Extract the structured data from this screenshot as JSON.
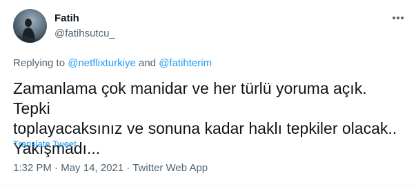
{
  "author": {
    "name": "Fatih",
    "handle": "@fatihsutcu_",
    "avatar_icon": "profile-photo"
  },
  "more_icon": "more-horizontal-icon",
  "reply": {
    "prefix": "Replying to ",
    "mention1": "@netflixturkiye",
    "conj": " and ",
    "mention2": "@fatihterim"
  },
  "tweet_text": "Zamanlama çok manidar ve her türlü yoruma açık. Tepki\ntoplayacaksınız ve sonuna kadar haklı tepkiler olacak..\nYakışmadı...",
  "translate_label": "Translate Tweet",
  "meta": {
    "time": "1:32 PM",
    "sep1": " · ",
    "date": "May 14, 2021",
    "sep2": " · ",
    "source": "Twitter Web App"
  },
  "colors": {
    "link": "#1d9bf0",
    "secondary_text": "#536471",
    "primary_text": "#0f1419"
  }
}
